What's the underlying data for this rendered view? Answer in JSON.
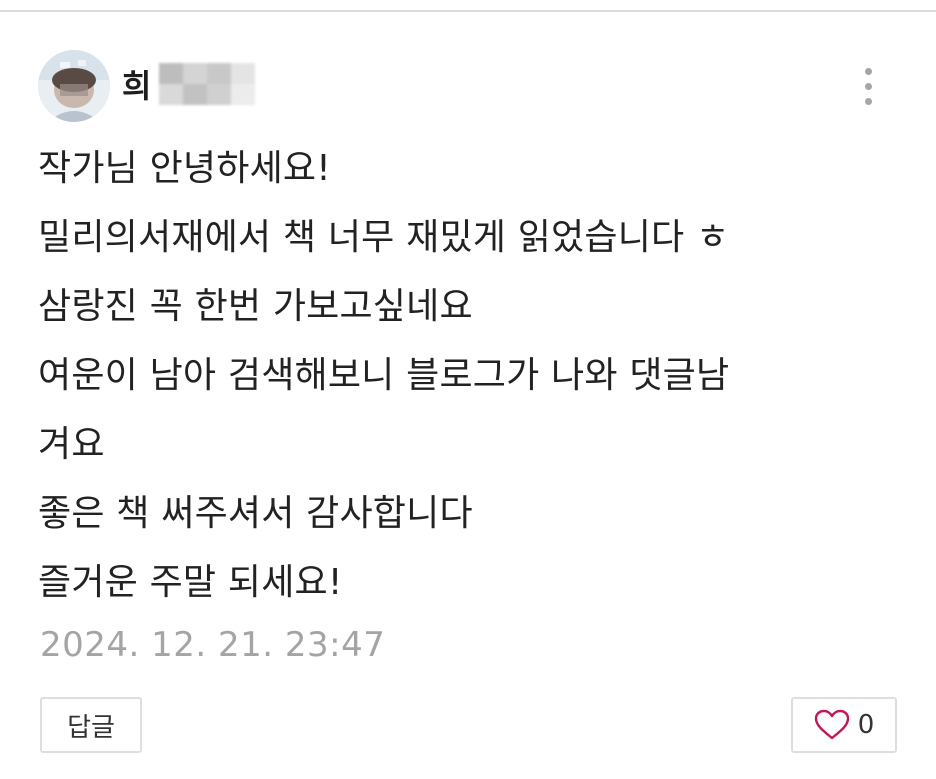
{
  "comment": {
    "author": {
      "name_visible": "희",
      "avatar_icon": "profile-photo-blurred",
      "blur_colors": [
        "#bdbdbd",
        "#d4d4d4",
        "#c8c8c8",
        "#e4e4e4",
        "#d9d9d9",
        "#c2c2c2",
        "#d0d0d0",
        "#ececec"
      ]
    },
    "more_icon": "vertical-ellipsis-icon",
    "lines": [
      "작가님 안녕하세요!",
      "밀리의서재에서 책 너무 재밌게 읽었습니다 ㅎ",
      "삼랑진 꼭 한번 가보고싶네요",
      "여운이 남아 검색해보니 블로그가 나와 댓글남",
      "겨요",
      "좋은 책 써주셔서 감사합니다",
      "즐거운 주말 되세요!"
    ],
    "timestamp": "2024. 12. 21. 23:47",
    "reply_label": "답글",
    "like": {
      "icon": "heart-outline-icon",
      "count": "0",
      "color": "#c2185b"
    }
  }
}
